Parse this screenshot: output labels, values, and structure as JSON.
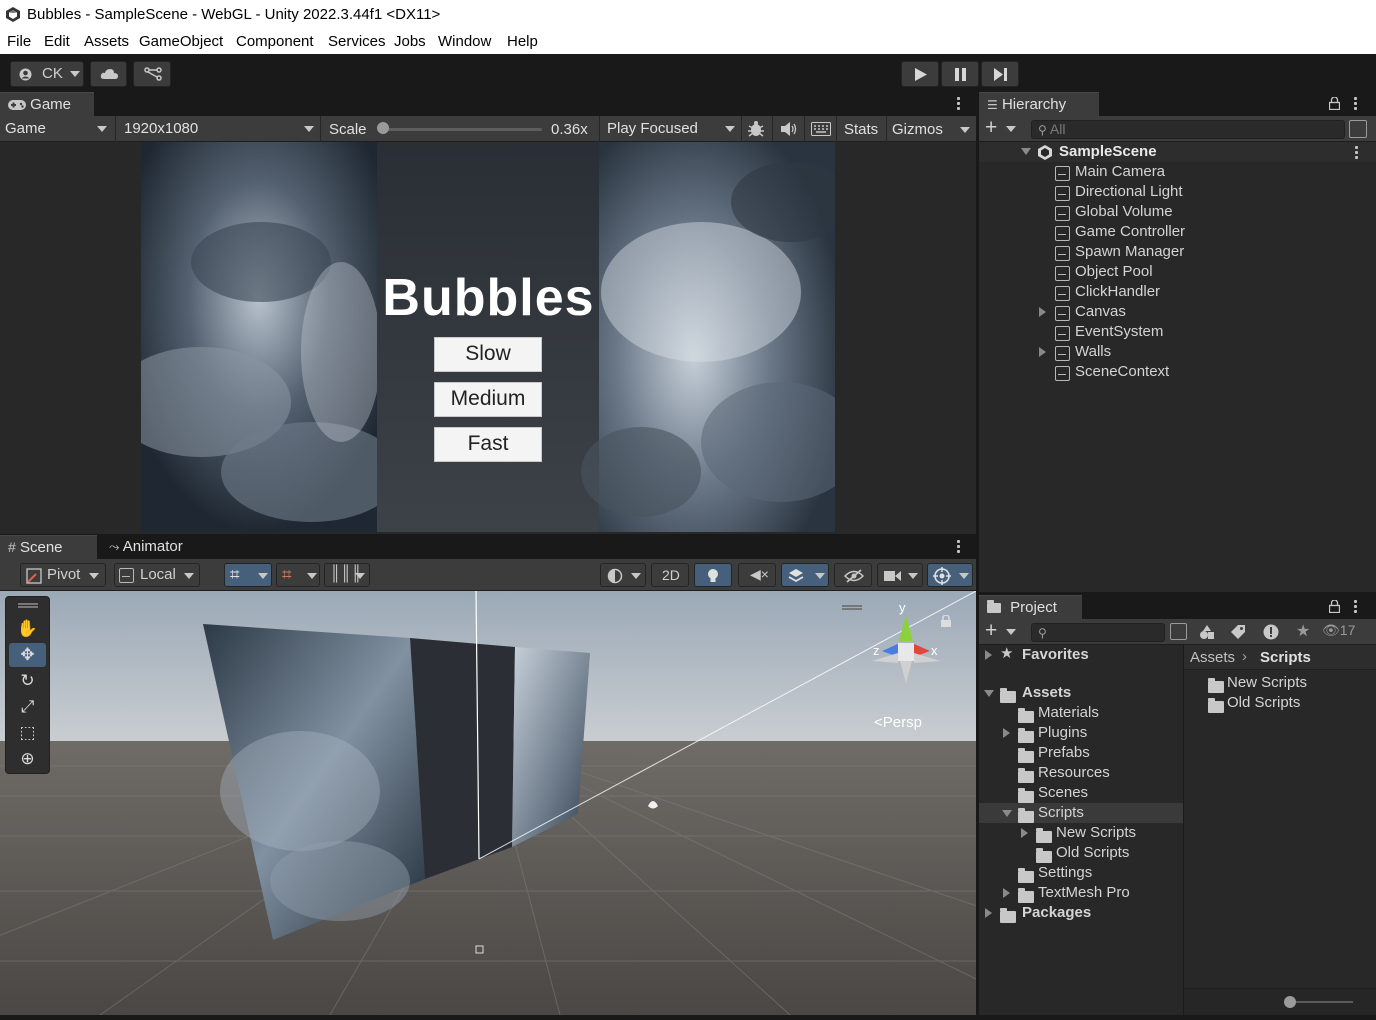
{
  "window": {
    "title": "Bubbles - SampleScene - WebGL - Unity 2022.3.44f1 <DX11>"
  },
  "menu": [
    "File",
    "Edit",
    "Assets",
    "GameObject",
    "Component",
    "Services",
    "Jobs",
    "Window",
    "Help"
  ],
  "toolbar": {
    "account": "CK"
  },
  "game": {
    "tab": "Game",
    "display": "Game",
    "resolution": "1920x1080",
    "scale_label": "Scale",
    "scale_value": "0.36x",
    "scale_fraction": 0.0,
    "play_mode": "Play Focused",
    "stats": "Stats",
    "gizmos": "Gizmos",
    "title": "Bubbles",
    "buttons": [
      "Slow",
      "Medium",
      "Fast"
    ]
  },
  "scene": {
    "tabs": [
      "Scene",
      "Animator"
    ],
    "pivot": "Pivot",
    "local": "Local",
    "mode_2d": "2D",
    "persp": "Persp",
    "gizmo_axes": {
      "y": "y",
      "x": "x",
      "z": "z"
    }
  },
  "hierarchy": {
    "tab": "Hierarchy",
    "search_placeholder": "All",
    "scene": "SampleScene",
    "items": [
      {
        "label": "Main Camera",
        "expandable": false
      },
      {
        "label": "Directional Light",
        "expandable": false
      },
      {
        "label": "Global Volume",
        "expandable": false
      },
      {
        "label": "Game Controller",
        "expandable": false
      },
      {
        "label": "Spawn Manager",
        "expandable": false
      },
      {
        "label": "Object Pool",
        "expandable": false
      },
      {
        "label": "ClickHandler",
        "expandable": false
      },
      {
        "label": "Canvas",
        "expandable": true
      },
      {
        "label": "EventSystem",
        "expandable": false
      },
      {
        "label": "Walls",
        "expandable": true
      },
      {
        "label": "SceneContext",
        "expandable": false
      }
    ]
  },
  "project": {
    "tab": "Project",
    "hidden_count": "17",
    "favorites": "Favorites",
    "assets": "Assets",
    "folders": [
      {
        "label": "Materials",
        "expandable": false
      },
      {
        "label": "Plugins",
        "expandable": true
      },
      {
        "label": "Prefabs",
        "expandable": false
      },
      {
        "label": "Resources",
        "expandable": false
      },
      {
        "label": "Scenes",
        "expandable": false
      },
      {
        "label": "Scripts",
        "expandable": true,
        "selected": true
      },
      {
        "label": "New Scripts",
        "expandable": true,
        "child": true
      },
      {
        "label": "Old Scripts",
        "expandable": false,
        "child": true
      },
      {
        "label": "Settings",
        "expandable": false
      },
      {
        "label": "TextMesh Pro",
        "expandable": true
      }
    ],
    "packages": "Packages",
    "breadcrumb": [
      "Assets",
      "Scripts"
    ],
    "contents": [
      "New Scripts",
      "Old Scripts"
    ]
  },
  "colors": {
    "accent": "#3a79bb",
    "panel": "#282828",
    "toolbar": "#3c3c3c"
  }
}
